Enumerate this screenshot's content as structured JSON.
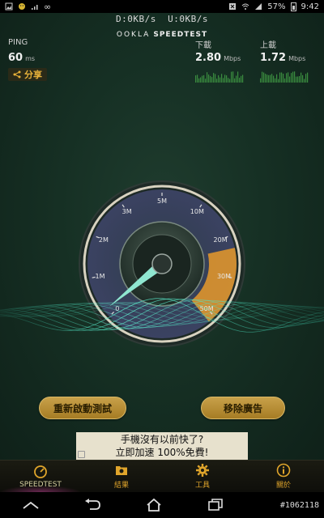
{
  "status_bar": {
    "battery": "57%",
    "time": "9:42",
    "icons": [
      "gallery-icon",
      "smiley-icon",
      "signal-icon",
      "infinity-icon",
      "mute-icon",
      "wifi-icon",
      "cell-signal-icon"
    ]
  },
  "header": {
    "download_rate": "D:0KB/s",
    "upload_rate": "U:0KB/s",
    "brand": "OOKLA",
    "brand_product": "SPEEDTEST"
  },
  "stats": {
    "ping_label": "PING",
    "ping_value": "60",
    "ping_unit": "ms",
    "download_label": "下載",
    "download_value": "2.80",
    "download_unit": "Mbps",
    "upload_label": "上載",
    "upload_value": "1.72",
    "upload_unit": "Mbps"
  },
  "share_label": "分享",
  "gauge": {
    "ticks": [
      "0",
      "1M",
      "2M",
      "3M",
      "5M",
      "10M",
      "20M",
      "30M",
      "50M"
    ],
    "needle_value": "0",
    "accent": "#e79a2a"
  },
  "buttons": {
    "restart": "重新啟動測試",
    "remove_ads": "移除廣告"
  },
  "ad": {
    "line1": "手機沒有以前快了?",
    "line2": "立即加速 100%免費!"
  },
  "tabs": [
    {
      "label": "SPEEDTEST",
      "icon": "speedometer-icon"
    },
    {
      "label": "結果",
      "icon": "results-folder-icon"
    },
    {
      "label": "工具",
      "icon": "gear-icon"
    },
    {
      "label": "關於",
      "icon": "info-icon"
    }
  ],
  "watermark": "#1062118",
  "colors": {
    "accent_gold": "#e0a52b",
    "gauge_orange": "#e79a2a",
    "teal_wave": "#3ad0b0"
  }
}
